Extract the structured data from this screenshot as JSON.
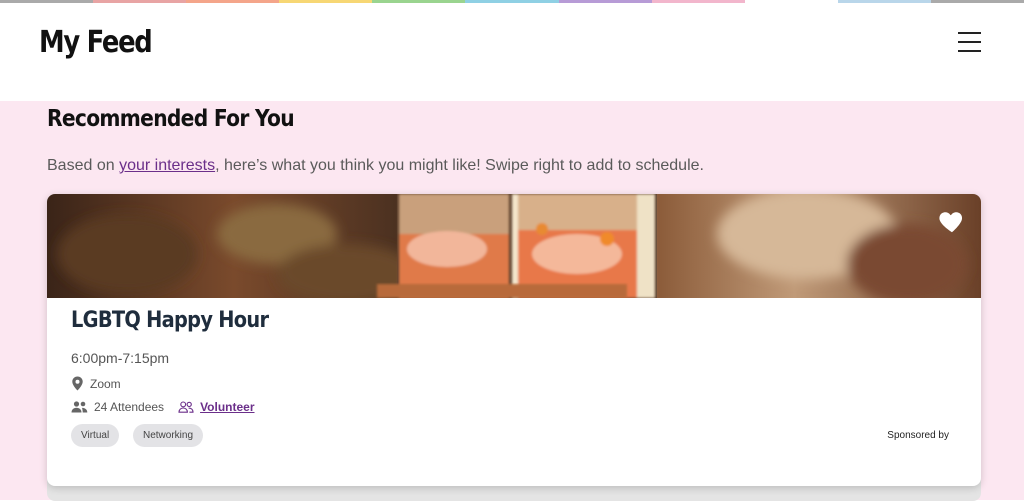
{
  "header": {
    "title": "My Feed",
    "menu_icon": "hamburger-menu-icon"
  },
  "rainbow_colors": [
    "#aaaaaa",
    "#e8a4a4",
    "#f4a58a",
    "#f7d774",
    "#9ad48f",
    "#8fd0e4",
    "#b79bd6",
    "#f2b6cc",
    "#ffffff",
    "#b9d6ea"
  ],
  "section": {
    "title": "Recommended For You",
    "intro_before": "Based on ",
    "intro_link": "your interests",
    "intro_after": ", here’s what you think you might like! Swipe right to add to schedule."
  },
  "event": {
    "title": "LGBTQ Happy Hour",
    "time": "6:00pm-7:15pm",
    "location": "Zoom",
    "attendees": "24 Attendees",
    "volunteer_label": "Volunteer",
    "tags": [
      "Virtual",
      "Networking"
    ],
    "sponsored_label": "Sponsored by",
    "favorite_icon": "heart-icon",
    "location_icon": "map-pin-icon",
    "attendees_icon": "people-icon",
    "volunteer_icon": "people-outline-icon"
  },
  "colors": {
    "accent": "#6b2f8a",
    "page_bg": "#fce7f1",
    "heading": "#1f2d3d"
  }
}
